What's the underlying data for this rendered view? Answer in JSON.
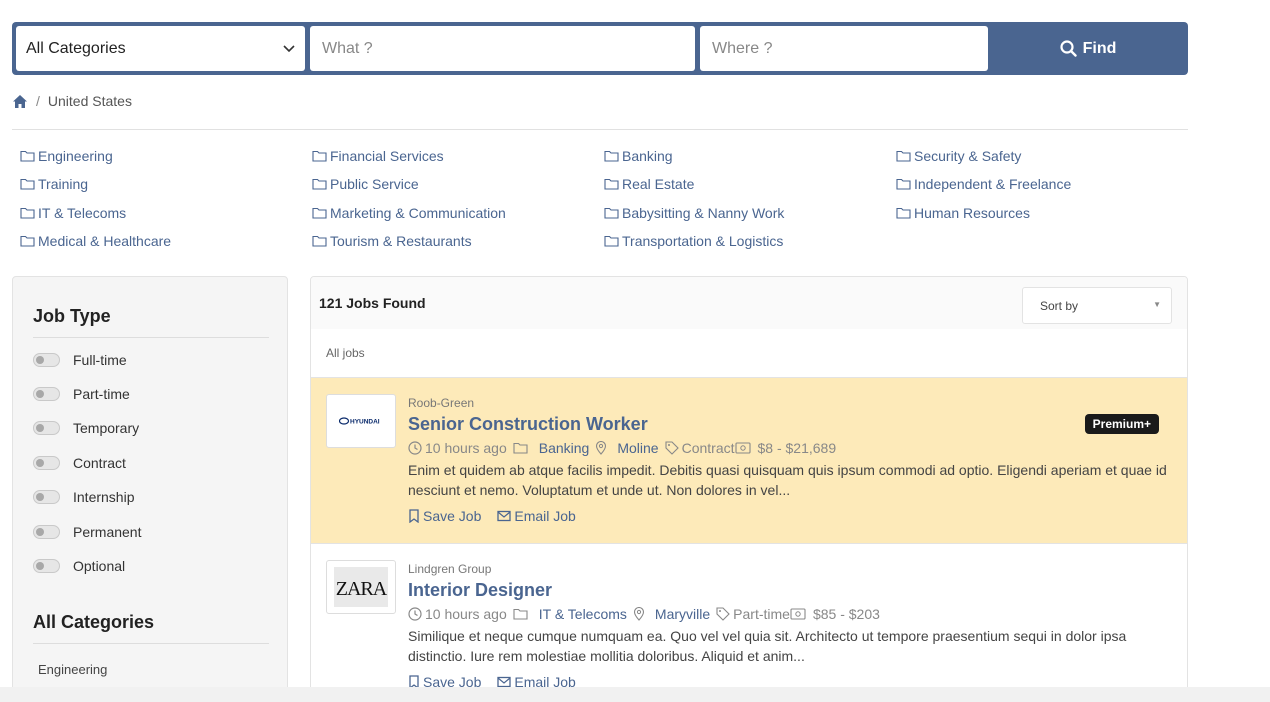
{
  "search": {
    "category": "All Categories",
    "what_placeholder": "What ?",
    "where_placeholder": "Where ?",
    "find_label": "Find"
  },
  "breadcrumb": {
    "sep": "/",
    "current": "United States"
  },
  "categories": [
    "Engineering",
    "Financial Services",
    "Banking",
    "Security & Safety",
    "Training",
    "Public Service",
    "Real Estate",
    "Independent & Freelance",
    "IT & Telecoms",
    "Marketing & Communication",
    "Babysitting & Nanny Work",
    "Human Resources",
    "Medical & Healthcare",
    "Tourism & Restaurants",
    "Transportation & Logistics"
  ],
  "sidebar": {
    "job_type_title": "Job Type",
    "job_types": [
      "Full-time",
      "Part-time",
      "Temporary",
      "Contract",
      "Internship",
      "Permanent",
      "Optional"
    ],
    "categories_title": "All Categories",
    "first_category": "Engineering"
  },
  "results": {
    "count_label": "121 Jobs Found",
    "sort_label": "Sort by",
    "tab_label": "All jobs"
  },
  "jobs": [
    {
      "company": "Roob-Green",
      "title": "Senior Construction Worker",
      "posted": "10 hours ago",
      "category": "Banking",
      "location": "Moline",
      "type": "Contract",
      "salary": "$8 - $21,689",
      "description": "Enim et quidem ab atque facilis impedit. Debitis quasi quisquam quis ipsum commodi ad optio. Eligendi aperiam et quae id nesciunt et nemo. Voluptatum et unde ut. Non dolores in vel...",
      "badge": "Premium+",
      "logo_text": "HYUNDAI"
    },
    {
      "company": "Lindgren Group",
      "title": "Interior Designer",
      "posted": "10 hours ago",
      "category": "IT & Telecoms",
      "location": "Maryville",
      "type": "Part-time",
      "salary": "$85 - $203",
      "description": "Similique et neque cumque numquam ea. Quo vel vel quia sit. Architecto ut tempore praesentium sequi in dolor ipsa distinctio. Iure rem molestiae mollitia doloribus. Aliquid et anim...",
      "logo_text": "ZARA"
    }
  ],
  "actions": {
    "save": "Save Job",
    "email": "Email Job"
  },
  "colors": {
    "brand": "#4a6590",
    "premium_bg": "#fdeab9",
    "badge_bg": "#1a1a1a"
  }
}
